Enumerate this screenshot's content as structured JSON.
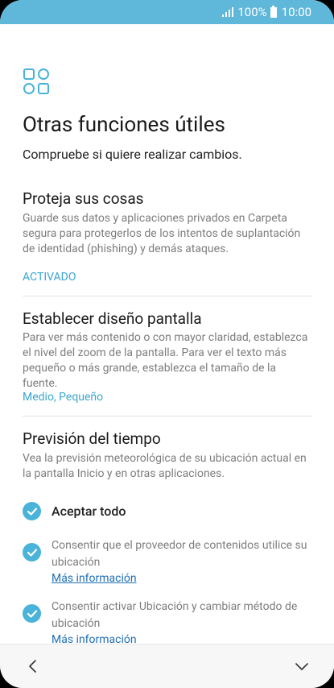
{
  "status_bar": {
    "battery": "100%",
    "time": "10:00"
  },
  "header": {
    "icon": "apps-grid-icon",
    "title": "Otras funciones útiles",
    "subtitle": "Compruebe si quiere realizar cambios."
  },
  "sections": [
    {
      "title": "Proteja sus cosas",
      "description": "Guarde sus datos y aplicaciones privados en Carpeta segura para protegerlos de los intentos de suplantación de identidad (phishing) y demás ataques.",
      "value": "ACTIVADO"
    },
    {
      "title": "Establecer diseño pantalla",
      "description": "Para ver más contenido o con mayor claridad, establezca el nivel del zoom de la pantalla. Para ver el texto más pequeño o más grande, establezca el tamaño de la fuente.",
      "value": "Medio, Pequeño"
    },
    {
      "title": "Previsión del tiempo",
      "description": "Vea la previsión meteorológica de su ubicación actual en la pantalla Inicio y en otras aplicaciones."
    }
  ],
  "consents": {
    "accept_all": "Aceptar todo",
    "items": [
      {
        "text": "Consentir que el proveedor de contenidos utilice su ubicación",
        "link": "Más información"
      },
      {
        "text": "Consentir activar Ubicación y cambiar método de ubicación",
        "link": "Más información"
      }
    ]
  },
  "navigation": {
    "back_icon": "chevron-left-icon",
    "next_icon": "chevron-down-icon"
  },
  "colors": {
    "status_bar": "#5fb7d9",
    "accent": "#3aa6cf",
    "check": "#4ab3d9",
    "link": "#1f6fb5"
  }
}
